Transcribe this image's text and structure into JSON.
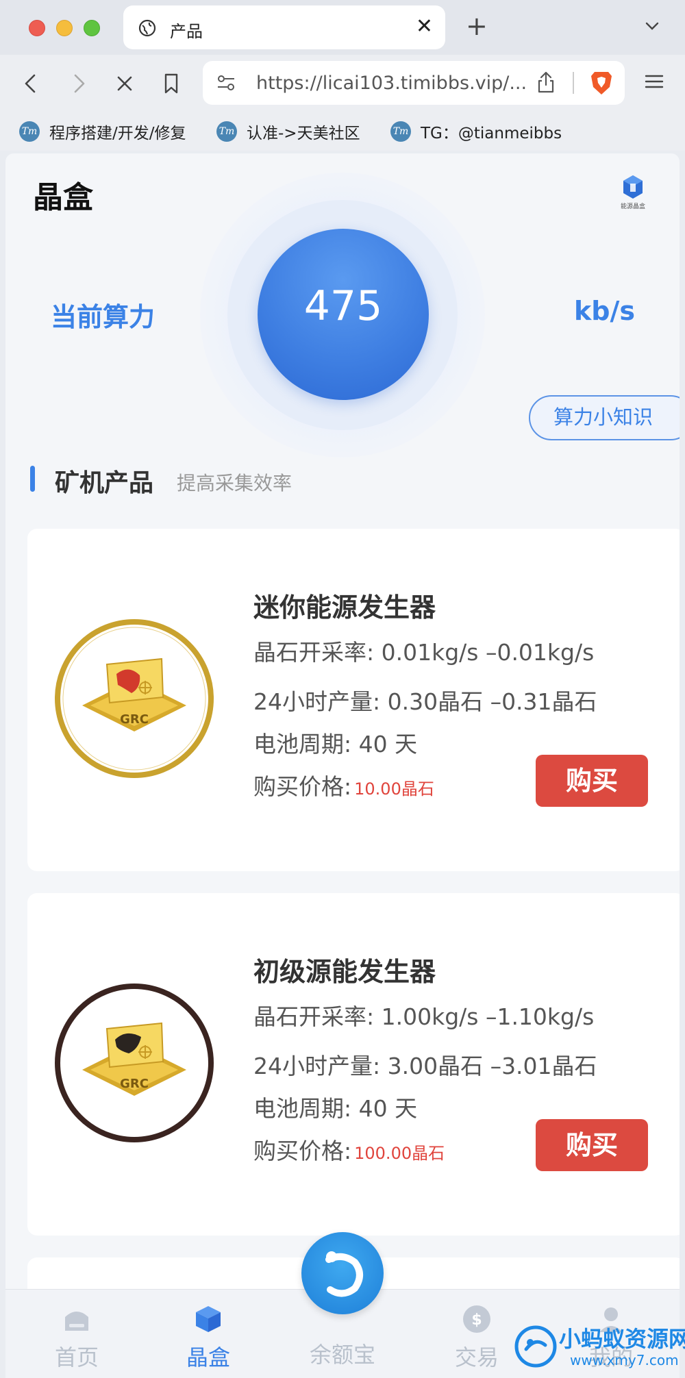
{
  "browser": {
    "tab_title": "产品",
    "tab_close": "✕",
    "new_tab": "+",
    "url": "https://licai103.timibbs.vip/...",
    "bookmarks": [
      {
        "icon_text": "Tm",
        "label": "程序搭建/开发/修复"
      },
      {
        "icon_text": "Tm",
        "label": "认准->天美社区"
      },
      {
        "icon_text": "Tm",
        "label": "TG：@tianmeibbs"
      }
    ]
  },
  "header": {
    "title": "晶盒",
    "logo_caption": "能源晶盒"
  },
  "hashrate": {
    "label": "当前算力",
    "value": "475",
    "unit": "kb/s",
    "tips_button": "算力小知识"
  },
  "section": {
    "title": "矿机产品",
    "subtitle": "提高采集效率"
  },
  "products": [
    {
      "name": "迷你能源发生器",
      "rate": "晶石开采率: 0.01kg/s –0.01kg/s",
      "output": "24小时产量: 0.30晶石 –0.31晶石",
      "cycle": "电池周期: 40 天",
      "price_label": "购买价格:",
      "price_value": "10.00晶石",
      "buy_label": "购买",
      "badge_text": "GRC",
      "ring_color": "#c9a22e"
    },
    {
      "name": "初级源能发生器",
      "rate": "晶石开采率: 1.00kg/s –1.10kg/s",
      "output": "24小时产量: 3.00晶石 –3.01晶石",
      "cycle": "电池周期: 40 天",
      "price_label": "购买价格:",
      "price_value": "100.00晶石",
      "buy_label": "购买",
      "badge_text": "GRC",
      "ring_color": "#3a2420"
    }
  ],
  "bottom_nav": [
    {
      "label": "首页",
      "icon": "home-icon",
      "active": false
    },
    {
      "label": "晶盒",
      "icon": "cube-icon",
      "active": true
    },
    {
      "label": "余额宝",
      "icon": "center-logo-icon",
      "active": false
    },
    {
      "label": "交易",
      "icon": "dollar-icon",
      "active": false
    },
    {
      "label": "我的",
      "icon": "user-icon",
      "active": false
    }
  ],
  "watermark": {
    "line1": "小蚂蚁资源网",
    "line2": "www.xmy7.com"
  },
  "colors": {
    "accent": "#3b82e6",
    "buy": "#dc4a40",
    "price": "#e0443c"
  }
}
